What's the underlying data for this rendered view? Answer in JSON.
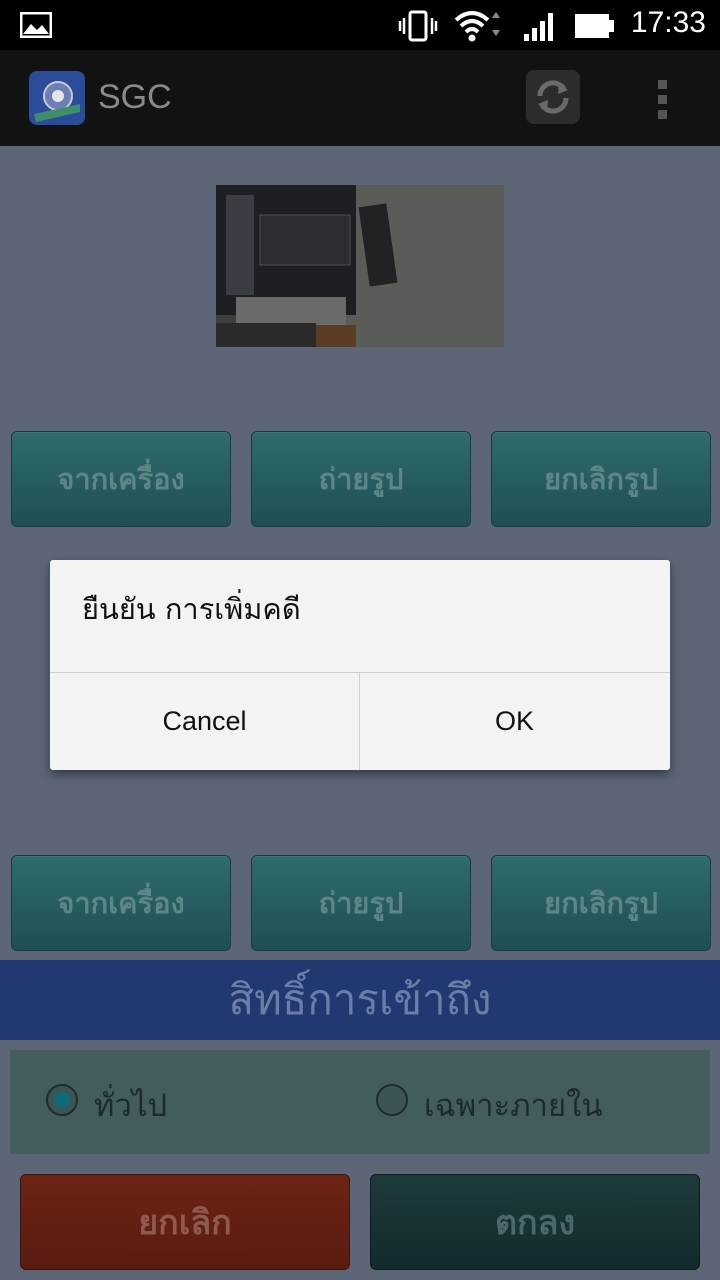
{
  "status_bar": {
    "time": "17:33"
  },
  "action_bar": {
    "title": "SGC"
  },
  "photo_buttons_top": [
    "จากเครื่อง",
    "ถ่ายรูป",
    "ยกเลิกรูป"
  ],
  "photo_buttons_bottom": [
    "จากเครื่อง",
    "ถ่ายรูป",
    "ยกเลิกรูป"
  ],
  "access": {
    "header": "สิทธิ์การเข้าถึง",
    "options": [
      {
        "label": "ทั่วไป",
        "selected": true
      },
      {
        "label": "เฉพาะภายใน",
        "selected": false
      }
    ]
  },
  "actions": {
    "cancel": "ยกเลิก",
    "ok": "ตกลง"
  },
  "dialog": {
    "message": "ยืนยัน การเพิ่มคดี",
    "cancel": "Cancel",
    "ok": "OK"
  }
}
